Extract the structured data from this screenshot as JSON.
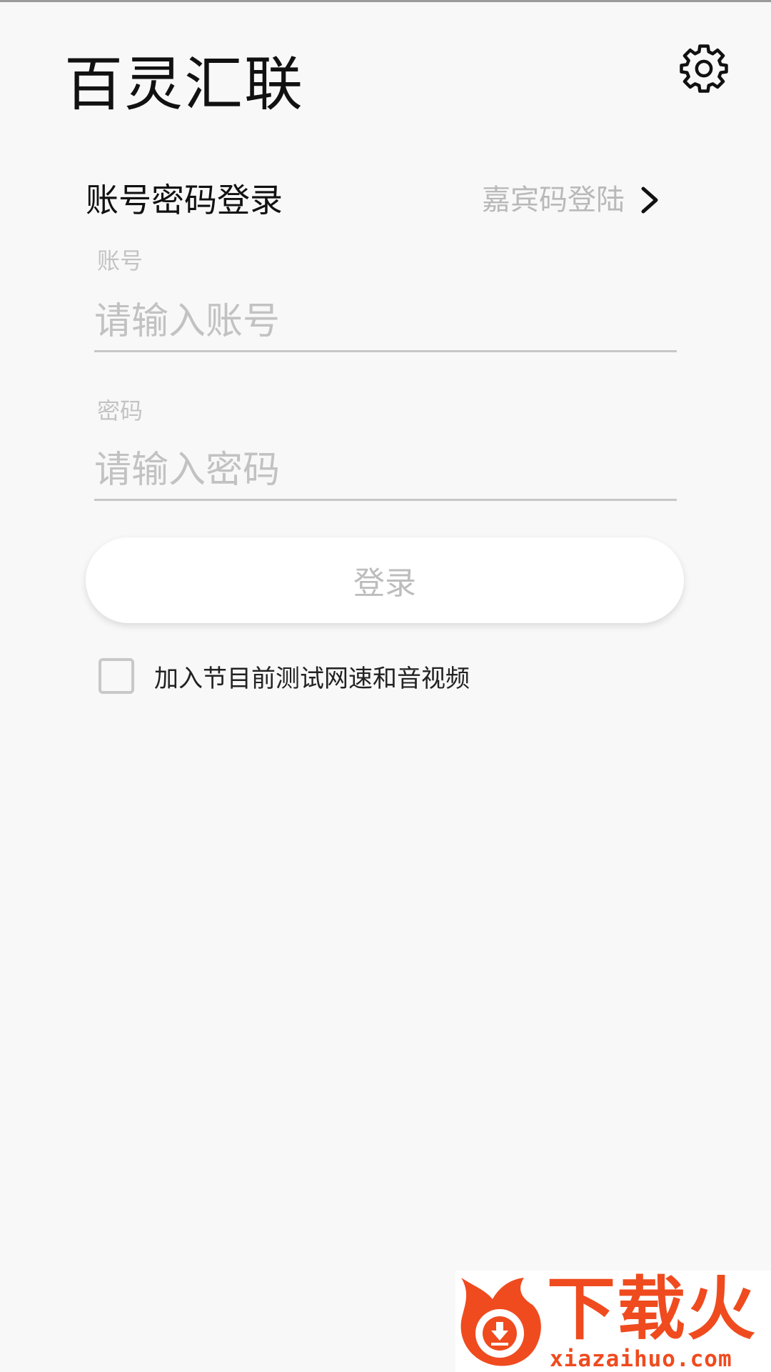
{
  "app": {
    "title": "百灵汇联"
  },
  "login_mode": {
    "title": "账号密码登录",
    "guest_link_label": "嘉宾码登陆"
  },
  "form": {
    "account_label": "账号",
    "account_placeholder": "请输入账号",
    "account_value": "",
    "password_label": "密码",
    "password_placeholder": "请输入密码",
    "password_value": "",
    "login_button": "登录",
    "pretest_label": "加入节目前测试网速和音视频",
    "pretest_checked": false
  },
  "watermark": {
    "brand": "下载火",
    "url": "xiazaihuo.com",
    "color": "#ef4b1f"
  },
  "icons": {
    "settings": "gear-icon",
    "guest_link": "chevron-right-icon",
    "watermark_logo": "download-logo-icon"
  }
}
